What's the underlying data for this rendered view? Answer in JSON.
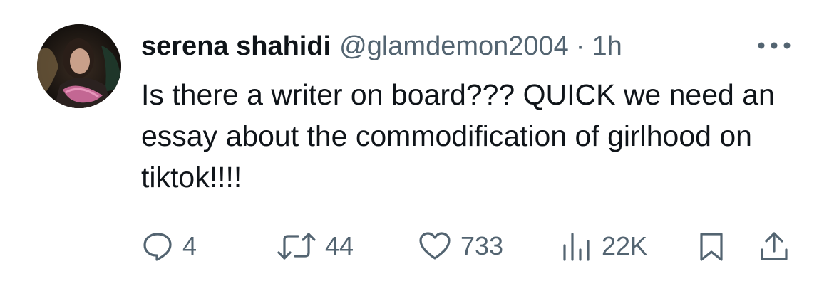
{
  "post": {
    "display_name": "serena shahidi",
    "handle": "@glamdemon2004",
    "separator": "·",
    "time": "1h",
    "text": "Is there a writer on board??? QUICK we need an essay about the commodification of girlhood on tiktok!!!!"
  },
  "actions": {
    "replies": "4",
    "reposts": "44",
    "likes": "733",
    "views": "22K"
  },
  "icons": {
    "more": "more-icon",
    "reply": "reply-icon",
    "repost": "repost-icon",
    "like": "heart-icon",
    "views": "views-icon",
    "bookmark": "bookmark-icon",
    "share": "share-icon"
  },
  "colors": {
    "text_primary": "#0f1419",
    "text_secondary": "#536471",
    "background": "#ffffff"
  }
}
